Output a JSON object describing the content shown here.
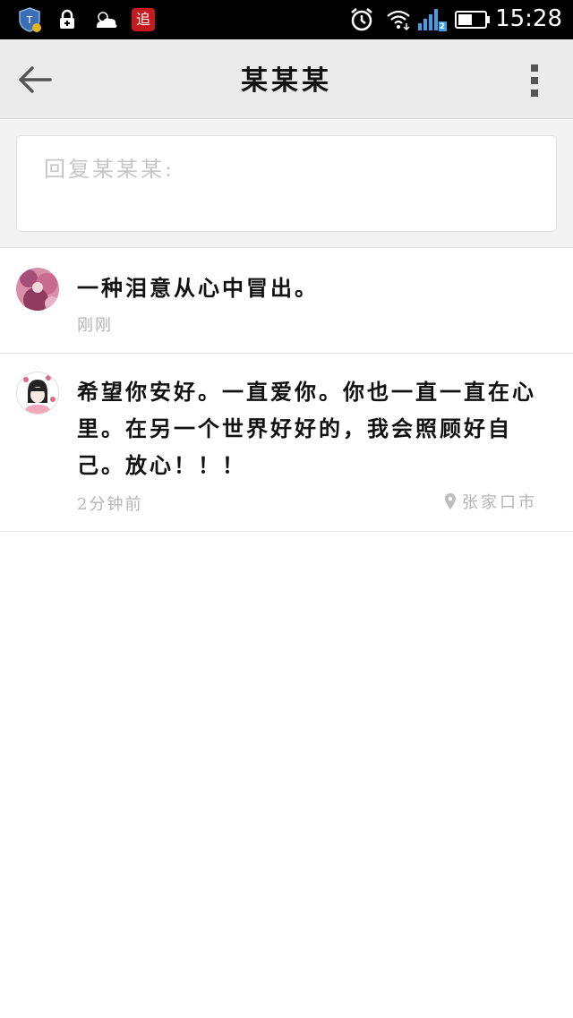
{
  "status_bar": {
    "time": "15:28",
    "sim_badge": "2",
    "app_icon_text": "追",
    "icons": [
      "shield-icon",
      "lock-icon",
      "weather-icon",
      "app-icon",
      "alarm-icon",
      "wifi-icon",
      "signal-icon",
      "battery-icon"
    ]
  },
  "header": {
    "title": "某某某"
  },
  "reply": {
    "placeholder": "回复某某某:"
  },
  "comments": [
    {
      "text": "一种泪意从心中冒出。",
      "time": "刚刚",
      "location": ""
    },
    {
      "text": "希望你安好。一直爱你。你也一直一直在心里。在另一个世界好好的，我会照顾好自己。放心！！！",
      "time": "2分钟前",
      "location": "张家口市"
    }
  ],
  "colors": {
    "status_bar": "#000000",
    "header_bg": "#ebebeb",
    "reply_bg": "#f2f2f2",
    "meta_text": "#b4b4b4"
  }
}
